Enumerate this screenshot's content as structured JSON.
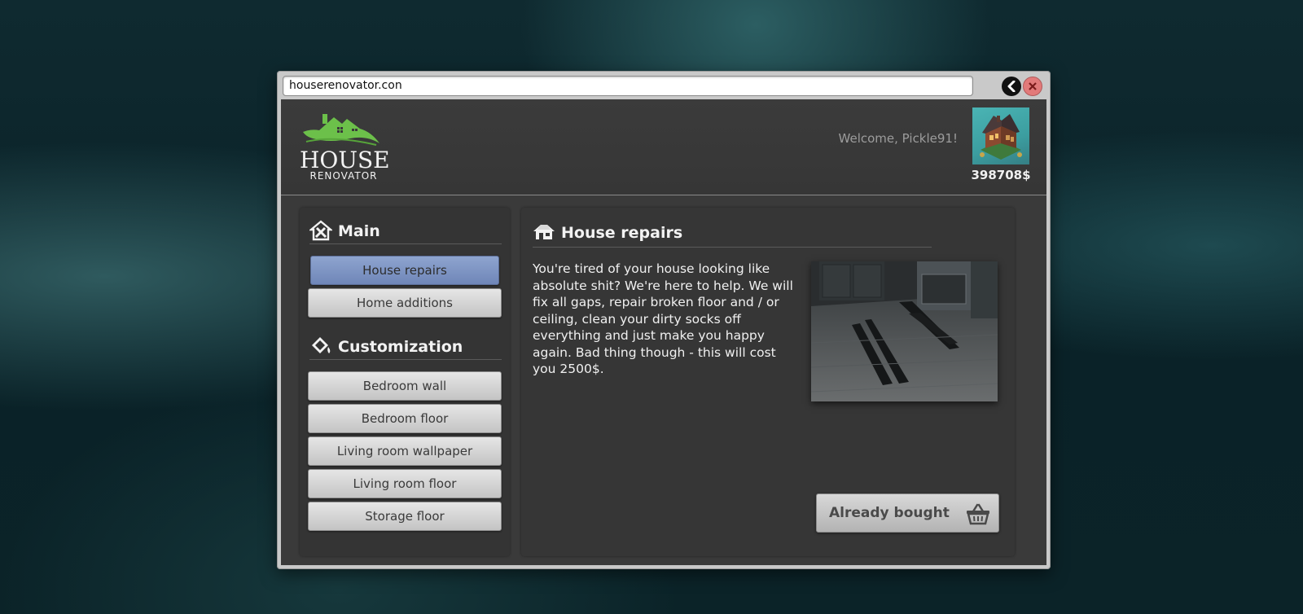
{
  "browser": {
    "url": "houserenovator.con",
    "back_icon": "chevron-left-icon",
    "close_icon": "close-icon"
  },
  "header": {
    "logo_title": "HOUSE",
    "logo_subtitle": "RENOVATOR",
    "welcome_text": "Welcome, Pickle91!",
    "balance": "398708$"
  },
  "sidebar": {
    "sections": [
      {
        "title": "Main",
        "icon": "house-tools-icon",
        "items": [
          {
            "label": "House repairs",
            "active": true
          },
          {
            "label": "Home additions",
            "active": false
          }
        ]
      },
      {
        "title": "Customization",
        "icon": "paint-bucket-icon",
        "items": [
          {
            "label": "Bedroom wall",
            "active": false
          },
          {
            "label": "Bedroom floor",
            "active": false
          },
          {
            "label": "Living room wallpaper",
            "active": false
          },
          {
            "label": "Living room floor",
            "active": false
          },
          {
            "label": "Storage floor",
            "active": false
          }
        ]
      }
    ]
  },
  "main": {
    "title": "House repairs",
    "icon": "house-icon",
    "description": "You're tired of your house looking like absolute shit? We're here to help. We will fix all gaps, repair broken floor and / or ceiling, clean your dirty socks off everything and just make you happy again. Bad thing though - this will cost you 2500$.",
    "buy_button_label": "Already bought",
    "buy_icon": "basket-icon"
  },
  "colors": {
    "accent_active": "#7b91c2",
    "logo_green": "#6cc04a",
    "panel_bg": "#363636"
  }
}
